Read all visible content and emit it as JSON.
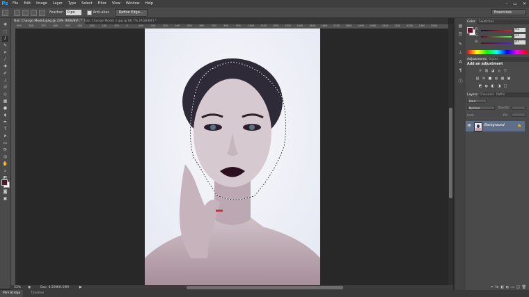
{
  "app": {
    "logo": "Ps"
  },
  "menu": [
    "File",
    "Edit",
    "Image",
    "Layer",
    "Type",
    "Select",
    "Filter",
    "View",
    "Window",
    "Help"
  ],
  "window_controls": [
    "–",
    "▭",
    "✕"
  ],
  "options_bar": {
    "feather_label": "Feather:",
    "feather_value": "0 px",
    "anti_alias_label": "Anti-alias",
    "refine_edge_label": "Refine Edge...",
    "workspace": "Essentials"
  },
  "tabs": [
    {
      "label": "Hair Change Model.jpeg @ 33% (RGB/8#) *",
      "active": true
    },
    {
      "label": "Hair Change Model 2.jpg @ 66.7% (RGB/8#) *",
      "active": false
    }
  ],
  "ruler_ticks": [
    "900",
    "800",
    "700",
    "600",
    "500",
    "400",
    "300",
    "200",
    "100",
    "0",
    "100",
    "200",
    "300",
    "400",
    "500",
    "600",
    "700",
    "800",
    "900",
    "1000",
    "1100",
    "1200",
    "1300",
    "1400",
    "1500",
    "1600",
    "1700",
    "1800",
    "1900",
    "2000",
    "2100",
    "2200",
    "2300",
    "2400",
    "2500"
  ],
  "status": {
    "zoom": "33%",
    "doc": "Doc: 6.59M/6.59M"
  },
  "bottom_tabs": [
    "Mini Bridge",
    "Timeline"
  ],
  "color_panel": {
    "tabs": [
      "Color",
      "Swatches"
    ],
    "channels": [
      {
        "label": "R",
        "value": "91",
        "color": "#b04a5a"
      },
      {
        "label": "G",
        "value": "21",
        "color": "#4caf50"
      },
      {
        "label": "B",
        "value": "47",
        "color": "#3a5bd0"
      }
    ],
    "foreground": "#5b152f",
    "background": "#ffffff"
  },
  "adjustments_panel": {
    "tabs": [
      "Adjustments",
      "Styles"
    ],
    "heading": "Add an adjustment",
    "row1_icons": [
      "☼",
      "▥",
      "◪",
      "◬",
      "▽"
    ],
    "row2_icons": [
      "▤",
      "⚖",
      "■",
      "◍",
      "▦",
      "▣"
    ],
    "row3_icons": [
      "◩",
      "◐",
      "◧",
      "◨",
      "▢"
    ]
  },
  "layers_panel": {
    "tabs": [
      "Layers",
      "Channels",
      "Paths"
    ],
    "filter_kind": "Kind",
    "blend_mode": "Normal",
    "opacity_label": "Opacity:",
    "lock_label": "Lock:",
    "fill_label": "Fill:",
    "layer_name": "Background",
    "footer_icons": [
      "⚭",
      "fx",
      "◧",
      "◐",
      "▭",
      "❑",
      "🗑"
    ]
  }
}
